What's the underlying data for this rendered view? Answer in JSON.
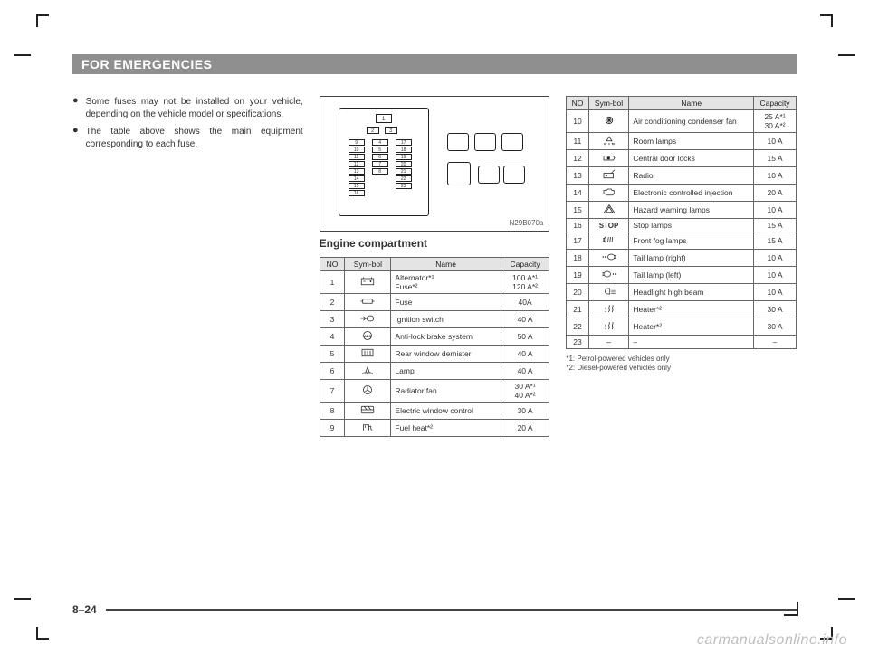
{
  "header": {
    "title": "FOR EMERGENCIES"
  },
  "col1": {
    "bullets": [
      "Some fuses may not be installed on your vehicle, depending on the vehicle model or specifications.",
      "The table above shows the main equipment corresponding to each fuse."
    ]
  },
  "diagram": {
    "label": "N29B070a"
  },
  "engine_heading": "Engine compartment",
  "table_headers": {
    "no": "NO",
    "symbol": "Sym-bol",
    "name": "Name",
    "capacity": "Capacity"
  },
  "engine_table": [
    {
      "no": "1",
      "sym": "battery",
      "name": "Alternator*¹\nFuse*²",
      "cap": "100 A*¹\n120 A*²"
    },
    {
      "no": "2",
      "sym": "fuse",
      "name": "Fuse",
      "cap": "40A"
    },
    {
      "no": "3",
      "sym": "ignition",
      "name": "Ignition switch",
      "cap": "40 A"
    },
    {
      "no": "4",
      "sym": "abs",
      "name": "Anti-lock brake system",
      "cap": "50 A"
    },
    {
      "no": "5",
      "sym": "demister",
      "name": "Rear window demister",
      "cap": "40 A"
    },
    {
      "no": "6",
      "sym": "lamp",
      "name": "Lamp",
      "cap": "40 A"
    },
    {
      "no": "7",
      "sym": "fan",
      "name": "Radiator fan",
      "cap": "30 A*¹\n40 A*²"
    },
    {
      "no": "8",
      "sym": "window",
      "name": "Electric window control",
      "cap": "30 A"
    },
    {
      "no": "9",
      "sym": "fuelheat",
      "name": "Fuel heat*²",
      "cap": "20 A"
    }
  ],
  "engine_table2": [
    {
      "no": "10",
      "sym": "ac",
      "name": "Air conditioning condenser fan",
      "cap": "25 A*¹\n30 A*²"
    },
    {
      "no": "11",
      "sym": "room",
      "name": "Room lamps",
      "cap": "10 A"
    },
    {
      "no": "12",
      "sym": "lock",
      "name": "Central door locks",
      "cap": "15 A"
    },
    {
      "no": "13",
      "sym": "radio",
      "name": "Radio",
      "cap": "10 A"
    },
    {
      "no": "14",
      "sym": "engine",
      "name": "Electronic controlled injection",
      "cap": "20 A"
    },
    {
      "no": "15",
      "sym": "hazard",
      "name": "Hazard warning lamps",
      "cap": "10 A"
    },
    {
      "no": "16",
      "sym": "stoptext",
      "name": "Stop lamps",
      "cap": "15 A"
    },
    {
      "no": "17",
      "sym": "fog",
      "name": "Front fog lamps",
      "cap": "15 A"
    },
    {
      "no": "18",
      "sym": "tailr",
      "name": "Tail lamp (right)",
      "cap": "10 A"
    },
    {
      "no": "19",
      "sym": "taill",
      "name": "Tail lamp (left)",
      "cap": "10 A"
    },
    {
      "no": "20",
      "sym": "highbeam",
      "name": "Headlight high beam",
      "cap": "10 A"
    },
    {
      "no": "21",
      "sym": "heater",
      "name": "Heater*²",
      "cap": "30 A"
    },
    {
      "no": "22",
      "sym": "heater",
      "name": "Heater*²",
      "cap": "30 A"
    },
    {
      "no": "23",
      "sym": "dash",
      "name": "–",
      "cap": "–"
    }
  ],
  "footnotes": [
    "*1: Petrol-powered vehicles only",
    "*2: Diesel-powered vehicles only"
  ],
  "page_number": "8–24",
  "watermark": "carmanualsonline.info"
}
